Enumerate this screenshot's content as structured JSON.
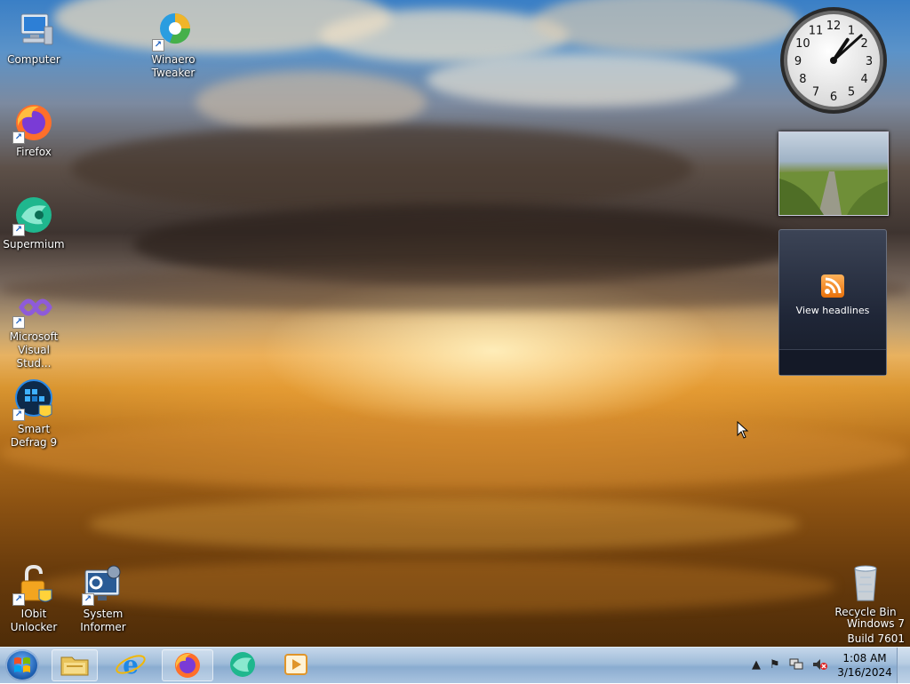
{
  "desktop": {
    "icons": [
      {
        "label": "Computer",
        "icon": "computer-icon"
      },
      {
        "label": "Winaero Tweaker",
        "icon": "winaero-tweaker-icon"
      },
      {
        "label": "Firefox",
        "icon": "firefox-icon"
      },
      {
        "label": "Supermium",
        "icon": "supermium-icon"
      },
      {
        "label": "Microsoft Visual Stud...",
        "icon": "visual-studio-icon"
      },
      {
        "label": "Smart Defrag 9",
        "icon": "smart-defrag-icon"
      },
      {
        "label": "IObit Unlocker",
        "icon": "iobit-unlocker-icon"
      },
      {
        "label": "System Informer",
        "icon": "system-informer-icon"
      },
      {
        "label": "Recycle Bin",
        "icon": "recycle-bin-icon"
      }
    ]
  },
  "gadgets": {
    "clock": {
      "hour": 1,
      "minute": 8,
      "numerals": [
        "12",
        "1",
        "2",
        "3",
        "4",
        "5",
        "6",
        "7",
        "8",
        "9",
        "10",
        "11"
      ]
    },
    "feed": {
      "label": "View headlines"
    }
  },
  "watermark": {
    "line1": "Windows 7",
    "line2": "Build 7601"
  },
  "taskbar": {
    "pinned": [
      "explorer-icon",
      "internet-explorer-icon",
      "firefox-icon",
      "supermium-icon",
      "media-player-icon"
    ],
    "tray": {
      "time": "1:08 AM",
      "date": "3/16/2024"
    }
  },
  "colors": {
    "taskbar": "#a9c3df",
    "feed_bg": "#1f2637",
    "rss": "#e8700a"
  }
}
